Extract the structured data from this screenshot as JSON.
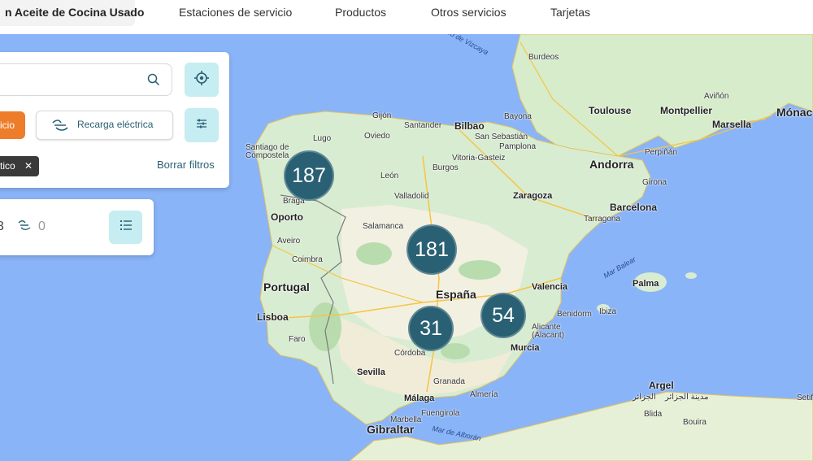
{
  "nav": {
    "active": "n Aceite de Cocina Usado",
    "items": [
      "Estaciones de servicio",
      "Productos",
      "Otros servicios",
      "Tarjetas"
    ]
  },
  "search": {
    "value": "",
    "placeholder": ""
  },
  "filters": {
    "active_label": "icio",
    "ev_label": "Recarga eléctrica",
    "chip_label": "tico",
    "clear_label": "Borrar filtros"
  },
  "counts": {
    "a": "3",
    "b": "0"
  },
  "clusters": [
    "187",
    "181",
    "31",
    "54"
  ],
  "map": {
    "cities": [
      "Burdeos",
      "Toulouse",
      "Montpellier",
      "Aviñón",
      "Marsella",
      "Mónac",
      "Bayona",
      "Andorra",
      "Perpiñán",
      "Girona",
      "Barcelona",
      "Tarragona",
      "Santander",
      "Bilbao",
      "Oviedo",
      "Gijón",
      "Lugo",
      "Santiago de Compostela",
      "San Sebastián",
      "Vitoria-Gasteiz",
      "Pamplona",
      "Burgos",
      "León",
      "Valladolid",
      "Zaragoza",
      "Salamanca",
      "Braga",
      "Oporto",
      "Aveiro",
      "Coimbra",
      "Portugal",
      "Lisboa",
      "Faro",
      "España",
      "Valencia",
      "Benidorm",
      "Alicante (Alacant)",
      "Murcia",
      "Palma",
      "Ibiza",
      "Córdoba",
      "Sevilla",
      "Granada",
      "Málaga",
      "Almería",
      "Fuengirola",
      "Marbella",
      "Gibraltar",
      "Argel",
      "الجزائر",
      "مدينة الجزائر",
      "Bouira",
      "Setif",
      "Blida",
      "Mar de Alborán",
      "Mar Balear",
      "Golfo de Vizcaya"
    ]
  },
  "colors": {
    "accent": "#2a6073",
    "orange": "#ee7d2b",
    "light": "#c6edf1",
    "sea": "#8ab4f8",
    "land": "#d8ecd2"
  }
}
